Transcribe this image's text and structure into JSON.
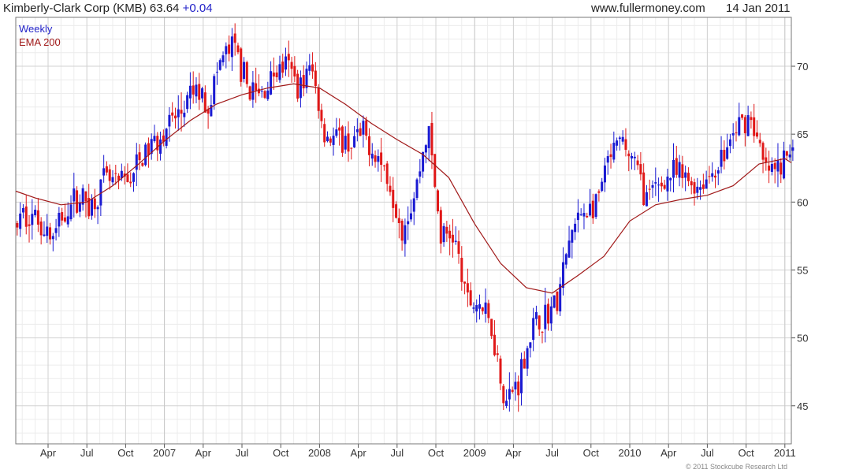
{
  "header": {
    "company": "Kimberly-Clark Corp (KMB)",
    "price": "63.64",
    "change": "+0.04",
    "site": "www.fullermoney.com",
    "date": "14 Jan 2011"
  },
  "credit": "© 2011 Stockcube Research Ltd",
  "colors": {
    "up": "#1a1ad2",
    "down": "#e01818",
    "ema": "#a01818",
    "grid": "#d2d2d2",
    "axis": "#555555",
    "legend_weekly": "#2323c8",
    "legend_ema": "#a01818"
  },
  "chart_data": {
    "type": "line",
    "series_kind": "weekly candlesticks with moving average",
    "legend": [
      "Weekly",
      "EMA 200"
    ],
    "y_ticks": [
      45,
      50,
      55,
      60,
      65,
      70
    ],
    "ylim": [
      42.2,
      73.6
    ],
    "x_ticks": [
      "Apr",
      "Jul",
      "Oct",
      "2007",
      "Apr",
      "Jul",
      "Oct",
      "2008",
      "Apr",
      "Jul",
      "Oct",
      "2009",
      "Apr",
      "Jul",
      "Oct",
      "2010",
      "Apr",
      "Jul",
      "Oct",
      "2011"
    ],
    "x_tick_months": [
      3,
      6,
      9,
      12,
      15,
      18,
      21,
      24,
      27,
      30,
      33,
      36,
      39,
      42,
      45,
      48,
      51,
      54,
      57,
      60
    ],
    "x_range_months": [
      0.5,
      60.5
    ],
    "x_start": "Jan 2006",
    "grid": true,
    "price_path": [
      [
        0.5,
        58.2
      ],
      [
        1.5,
        59.2
      ],
      [
        2.5,
        58.6
      ],
      [
        3.5,
        57.3
      ],
      [
        4.5,
        59.6
      ],
      [
        5.5,
        60.4
      ],
      [
        6.5,
        59.8
      ],
      [
        7.5,
        61.6
      ],
      [
        8.5,
        61.2
      ],
      [
        9.5,
        61.9
      ],
      [
        10.5,
        63.4
      ],
      [
        11.5,
        64.6
      ],
      [
        12.5,
        65.8
      ],
      [
        13.5,
        66.6
      ],
      [
        14.5,
        68.3
      ],
      [
        15.5,
        67.2
      ],
      [
        16.5,
        70.5
      ],
      [
        17.5,
        71.4
      ],
      [
        18.5,
        68.6
      ],
      [
        19.5,
        67.7
      ],
      [
        20.5,
        69.4
      ],
      [
        21.5,
        70.1
      ],
      [
        22.5,
        68.5
      ],
      [
        23.5,
        69.9
      ],
      [
        24.5,
        65.1
      ],
      [
        25.5,
        64.5
      ],
      [
        26.5,
        64.3
      ],
      [
        27.5,
        64.9
      ],
      [
        28.5,
        63.6
      ],
      [
        29.5,
        61.6
      ],
      [
        30.5,
        58.2
      ],
      [
        31.5,
        60.6
      ],
      [
        32.5,
        65.6
      ],
      [
        33.5,
        57.4
      ],
      [
        34.5,
        57.6
      ],
      [
        35.5,
        52.6
      ],
      [
        36.5,
        52.6
      ],
      [
        37.5,
        50.5
      ],
      [
        38.5,
        45.2
      ],
      [
        39.5,
        46.9
      ],
      [
        40.5,
        50.6
      ],
      [
        41.5,
        51.6
      ],
      [
        42.5,
        52.6
      ],
      [
        43.5,
        57.4
      ],
      [
        44.5,
        59.4
      ],
      [
        45.5,
        59.6
      ],
      [
        46.5,
        63.1
      ],
      [
        47.5,
        64.4
      ],
      [
        48.5,
        62.8
      ],
      [
        49.5,
        60.1
      ],
      [
        50.5,
        61.4
      ],
      [
        51.5,
        62.1
      ],
      [
        52.5,
        61.6
      ],
      [
        53.5,
        61.2
      ],
      [
        54.5,
        62.2
      ],
      [
        55.5,
        63.6
      ],
      [
        56.5,
        65.6
      ],
      [
        57.5,
        66.4
      ],
      [
        58.5,
        62.4
      ],
      [
        59.5,
        62.2
      ],
      [
        60.5,
        63.6
      ]
    ],
    "ema_200": [
      [
        0.5,
        60.8
      ],
      [
        2,
        60.3
      ],
      [
        4,
        59.8
      ],
      [
        6,
        60.0
      ],
      [
        8,
        61.2
      ],
      [
        10,
        62.8
      ],
      [
        12,
        64.5
      ],
      [
        14,
        66.0
      ],
      [
        16,
        67.2
      ],
      [
        18,
        67.9
      ],
      [
        20,
        68.4
      ],
      [
        22,
        68.7
      ],
      [
        24,
        68.4
      ],
      [
        26,
        67.2
      ],
      [
        28,
        65.8
      ],
      [
        30,
        64.6
      ],
      [
        32,
        63.5
      ],
      [
        34,
        61.8
      ],
      [
        36,
        58.4
      ],
      [
        38,
        55.5
      ],
      [
        40,
        53.7
      ],
      [
        42,
        53.3
      ],
      [
        44,
        54.6
      ],
      [
        46,
        56.0
      ],
      [
        48,
        58.6
      ],
      [
        50,
        59.8
      ],
      [
        52,
        60.2
      ],
      [
        54,
        60.5
      ],
      [
        56,
        61.2
      ],
      [
        58,
        62.8
      ],
      [
        60,
        63.2
      ],
      [
        60.5,
        62.9
      ]
    ]
  }
}
